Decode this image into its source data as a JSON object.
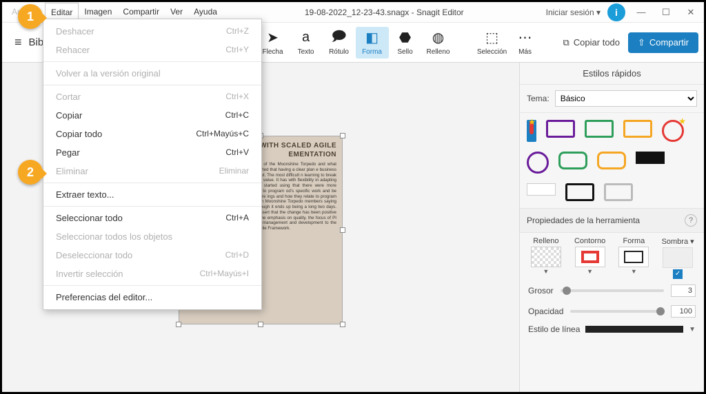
{
  "title": "19-08-2022_12-23-43.snagx - Snagit Editor",
  "signin": "Iniciar sesión",
  "menubar": [
    "Archivo",
    "Editar",
    "Imagen",
    "Compartir",
    "Ver",
    "Ayuda"
  ],
  "library": "Biblioteca",
  "tools": {
    "flecha": "Flecha",
    "texto": "Texto",
    "rotulo": "Rótulo",
    "forma": "Forma",
    "sello": "Sello",
    "relleno": "Relleno",
    "seleccion": "Selección",
    "mas": "Más"
  },
  "copy_all": "Copiar todo",
  "share": "Compartir",
  "dropdown": [
    {
      "label": "Deshacer",
      "shortcut": "Ctrl+Z",
      "disabled": true
    },
    {
      "label": "Rehacer",
      "shortcut": "Ctrl+Y",
      "disabled": true
    },
    {
      "sep": true
    },
    {
      "label": "Volver a la versión original",
      "shortcut": "",
      "disabled": true
    },
    {
      "sep": true
    },
    {
      "label": "Cortar",
      "shortcut": "Ctrl+X",
      "disabled": true
    },
    {
      "label": "Copiar",
      "shortcut": "Ctrl+C",
      "disabled": false
    },
    {
      "label": "Copiar todo",
      "shortcut": "Ctrl+Mayús+C",
      "disabled": false
    },
    {
      "label": "Pegar",
      "shortcut": "Ctrl+V",
      "disabled": false
    },
    {
      "label": "Eliminar",
      "shortcut": "Eliminar",
      "disabled": true
    },
    {
      "sep": true
    },
    {
      "label": "Extraer texto...",
      "shortcut": "",
      "disabled": false,
      "highlight": true
    },
    {
      "sep": true
    },
    {
      "label": "Seleccionar todo",
      "shortcut": "Ctrl+A",
      "disabled": false
    },
    {
      "label": "Seleccionar todos los objetos",
      "shortcut": "",
      "disabled": true
    },
    {
      "label": "Deseleccionar todo",
      "shortcut": "Ctrl+D",
      "disabled": true
    },
    {
      "label": "Invertir selección",
      "shortcut": "Ctrl+Mayús+I",
      "disabled": true
    },
    {
      "sep": true
    },
    {
      "label": "Preferencias del editor...",
      "shortcut": "",
      "disabled": false
    }
  ],
  "doc": {
    "heading": "WITH SCALED AGILE\nEMENTATION",
    "body": "p for their own Scaled Agile members of the Moonshine Torpedo and what others can expect as their own ints reported that having a clear plan e business and the developers on the ts of the rollout. The most difficult n learning to break things down into ated well and will have value. It has with flexibility in adapting to change. their daily work since we started using that there were more meetings but ings and how they relate to program od's specific work and be more to the program level goals. Pods are ings and how they relate to program was regarded as long but beneficial with Moonshine Torpedo members saying that it is helpful and necessary even though it ends up being a long two days. Finally, Moonshine Torpedo members assert that the change has been positive overall but does need more adapting. The emphasis on quality, the focus of PI Planning, and the commitment of both management and development to the plan are all positive aspects of Scaled Agile Framework."
  },
  "right": {
    "quick_styles": "Estilos rápidos",
    "theme_label": "Tema:",
    "theme_value": "Básico",
    "tool_props": "Propiedades de la herramienta",
    "fill": "Relleno",
    "outline": "Contorno",
    "shape": "Forma",
    "shadow": "Sombra",
    "thickness": "Grosor",
    "thickness_val": "3",
    "opacity": "Opacidad",
    "opacity_val": "100",
    "line_style": "Estilo de línea"
  },
  "callouts": {
    "one": "1",
    "two": "2"
  }
}
